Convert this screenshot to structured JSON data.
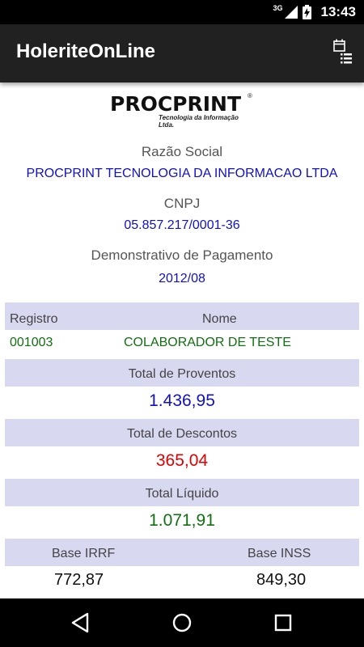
{
  "status_bar": {
    "network": "3G",
    "time": "13:43",
    "icons": [
      "network-3g-icon",
      "signal-icon",
      "battery-charging-icon"
    ]
  },
  "app_bar": {
    "title": "HoleriteOnLine",
    "action_icon": "calendar-list-icon"
  },
  "company": {
    "logo_text": "PROCPRINT",
    "logo_subtitle": "Tecnologia da Informação Ltda.",
    "logo_registered": "®",
    "razao_social_label": "Razão Social",
    "razao_social_value": "PROCPRINT TECNOLOGIA DA INFORMACAO LTDA",
    "cnpj_label": "CNPJ",
    "cnpj_value": "05.857.217/0001-36",
    "demonstrativo_label": "Demonstrativo de Pagamento",
    "demonstrativo_value": "2012/08"
  },
  "employee": {
    "registro_header": "Registro",
    "nome_header": "Nome",
    "registro_value": "001003",
    "nome_value": "COLABORADOR DE TESTE"
  },
  "totals": {
    "proventos_label": "Total de Proventos",
    "proventos_value": "1.436,95",
    "descontos_label": "Total de Descontos",
    "descontos_value": "365,04",
    "liquido_label": "Total Líquido",
    "liquido_value": "1.071,91"
  },
  "bases": {
    "irrf_label": "Base IRRF",
    "irrf_value": "772,87",
    "inss_label": "Base INSS",
    "inss_value": "849,30"
  },
  "colors": {
    "blue_value": "#1010c8",
    "red_value": "#e00000",
    "green_value": "#107010",
    "band": "#d8d8f0"
  },
  "nav_bar": {
    "icons": [
      "back-icon",
      "home-icon",
      "recents-icon"
    ]
  }
}
